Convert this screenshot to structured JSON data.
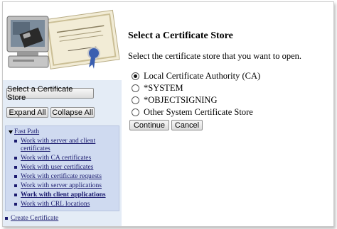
{
  "left_panel": {
    "select_store_button": "Select a Certificate Store",
    "expand_all_button": "Expand All",
    "collapse_all_button": "Collapse All",
    "fast_path": {
      "label": "Fast Path",
      "items": [
        {
          "label": "Work with server and client certificates",
          "bold": false
        },
        {
          "label": "Work with CA certificates",
          "bold": false
        },
        {
          "label": "Work with user certificates",
          "bold": false
        },
        {
          "label": "Work with certificate requests",
          "bold": false
        },
        {
          "label": "Work with server applications",
          "bold": false
        },
        {
          "label": "Work with client applications",
          "bold": true
        },
        {
          "label": "Work with CRL locations",
          "bold": false
        }
      ]
    },
    "create_certificate_link": "Create Certificate"
  },
  "main": {
    "title": "Select a Certificate Store",
    "description": "Select the certificate store that you want to open.",
    "options": [
      {
        "label": "Local Certificate Authority (CA)",
        "selected": true
      },
      {
        "label": "*SYSTEM",
        "selected": false
      },
      {
        "label": "*OBJECTSIGNING",
        "selected": false
      },
      {
        "label": "Other System Certificate Store",
        "selected": false
      }
    ],
    "continue_button": "Continue",
    "cancel_button": "Cancel"
  },
  "colors": {
    "left_panel_bg": "#e4ecf6",
    "nav_box_bg": "#cfdaf0",
    "link_color": "#1a1a6e"
  },
  "icons": {
    "banner": "certificate-computer-illustration-icon",
    "fast_path_toggle": "triangle-down-icon",
    "bullet": "square-bullet-icon"
  }
}
